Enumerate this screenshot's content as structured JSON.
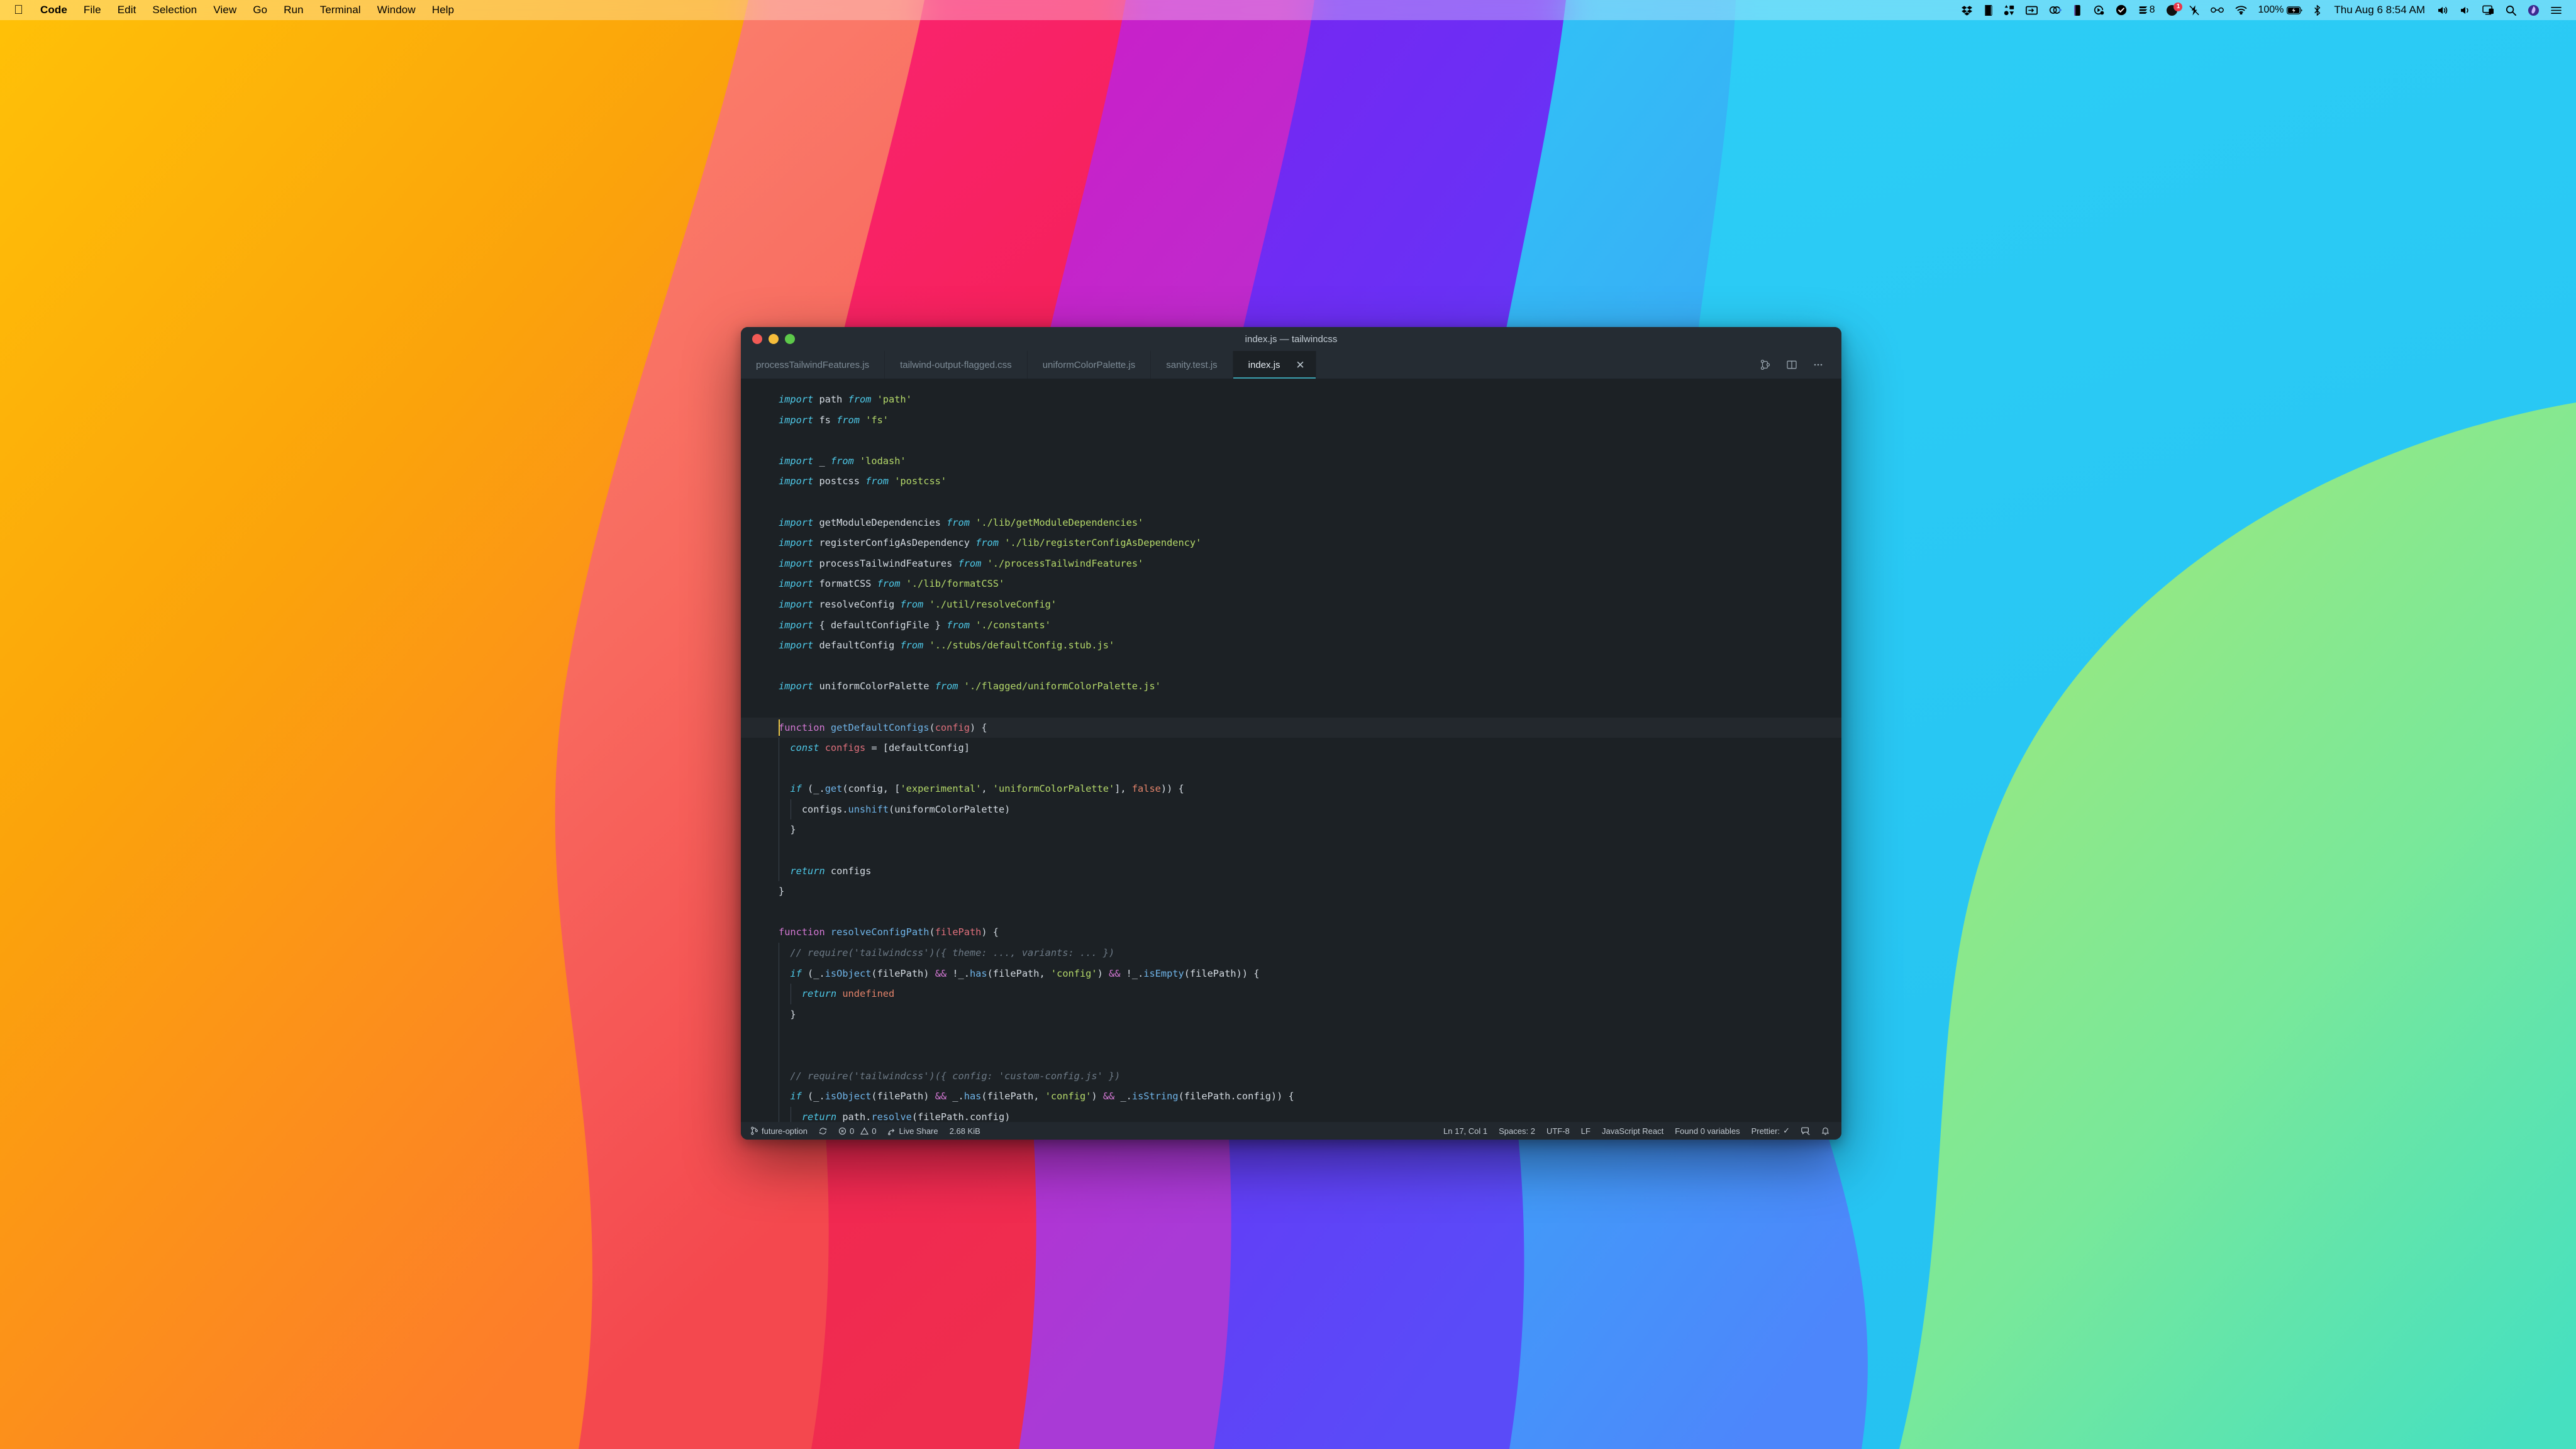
{
  "menubar": {
    "apple_icon": "apple-logo-icon",
    "items": [
      {
        "label": "Code",
        "bold": true
      },
      {
        "label": "File",
        "bold": false
      },
      {
        "label": "Edit",
        "bold": false
      },
      {
        "label": "Selection",
        "bold": false
      },
      {
        "label": "View",
        "bold": false
      },
      {
        "label": "Go",
        "bold": false
      },
      {
        "label": "Run",
        "bold": false
      },
      {
        "label": "Terminal",
        "bold": false
      },
      {
        "label": "Window",
        "bold": false
      },
      {
        "label": "Help",
        "bold": false
      }
    ],
    "status_icons": [
      "dropbox-icon",
      "book-icon",
      "shapes-icon",
      "display-icon",
      "link-icon",
      "book-alt-icon",
      "play-circle-icon",
      "checkmark-circle-icon",
      "layers-icon"
    ],
    "layers_count": "8",
    "notification_badge": "1",
    "dnd_icon": "do-not-disturb-icon",
    "glasses_icon": "glasses-icon",
    "wifi_icon": "wifi-icon",
    "battery_percent": "100%",
    "battery_icon": "battery-charging-icon",
    "bluetooth_icon": "bluetooth-icon",
    "clock": "Thu Aug 6  8:54 AM",
    "volume_icon": "volume-icon",
    "sound_icon": "sound-icon",
    "screen_mirror_icon": "screen-mirroring-icon",
    "search_icon": "spotlight-search-icon",
    "siri_icon": "siri-icon",
    "control_center_icon": "control-center-icon"
  },
  "window": {
    "title": "index.js — tailwindcss",
    "traffic_lights": [
      "close-button",
      "minimize-button",
      "maximize-button"
    ]
  },
  "tabs": [
    {
      "label": "processTailwindFeatures.js",
      "active": false
    },
    {
      "label": "tailwind-output-flagged.css",
      "active": false
    },
    {
      "label": "uniformColorPalette.js",
      "active": false
    },
    {
      "label": "sanity.test.js",
      "active": false
    },
    {
      "label": "index.js",
      "active": true
    }
  ],
  "tab_close_glyph": "✕",
  "tab_actions": [
    "split-diff-icon",
    "split-editor-icon",
    "more-actions-icon"
  ],
  "editor": {
    "accent": "#3b9fae",
    "background": "#1c2125",
    "current_line": 17,
    "lines": [
      {
        "n": 1,
        "tokens": [
          {
            "t": "import",
            "c": "k-imp"
          },
          {
            "t": " path ",
            "c": "k-plain"
          },
          {
            "t": "from",
            "c": "k-imp"
          },
          {
            "t": " ",
            "c": "k-plain"
          },
          {
            "t": "'path'",
            "c": "k-str"
          }
        ]
      },
      {
        "n": 2,
        "tokens": [
          {
            "t": "import",
            "c": "k-imp"
          },
          {
            "t": " fs ",
            "c": "k-plain"
          },
          {
            "t": "from",
            "c": "k-imp"
          },
          {
            "t": " ",
            "c": "k-plain"
          },
          {
            "t": "'fs'",
            "c": "k-str"
          }
        ]
      },
      {
        "n": 3,
        "tokens": []
      },
      {
        "n": 4,
        "tokens": [
          {
            "t": "import",
            "c": "k-imp"
          },
          {
            "t": " _ ",
            "c": "k-plain"
          },
          {
            "t": "from",
            "c": "k-imp"
          },
          {
            "t": " ",
            "c": "k-plain"
          },
          {
            "t": "'lodash'",
            "c": "k-str"
          }
        ]
      },
      {
        "n": 5,
        "tokens": [
          {
            "t": "import",
            "c": "k-imp"
          },
          {
            "t": " postcss ",
            "c": "k-plain"
          },
          {
            "t": "from",
            "c": "k-imp"
          },
          {
            "t": " ",
            "c": "k-plain"
          },
          {
            "t": "'postcss'",
            "c": "k-str"
          }
        ]
      },
      {
        "n": 6,
        "tokens": []
      },
      {
        "n": 7,
        "tokens": [
          {
            "t": "import",
            "c": "k-imp"
          },
          {
            "t": " getModuleDependencies ",
            "c": "k-plain"
          },
          {
            "t": "from",
            "c": "k-imp"
          },
          {
            "t": " ",
            "c": "k-plain"
          },
          {
            "t": "'./lib/getModuleDependencies'",
            "c": "k-str"
          }
        ]
      },
      {
        "n": 8,
        "tokens": [
          {
            "t": "import",
            "c": "k-imp"
          },
          {
            "t": " registerConfigAsDependency ",
            "c": "k-plain"
          },
          {
            "t": "from",
            "c": "k-imp"
          },
          {
            "t": " ",
            "c": "k-plain"
          },
          {
            "t": "'./lib/registerConfigAsDependency'",
            "c": "k-str"
          }
        ]
      },
      {
        "n": 9,
        "tokens": [
          {
            "t": "import",
            "c": "k-imp"
          },
          {
            "t": " processTailwindFeatures ",
            "c": "k-plain"
          },
          {
            "t": "from",
            "c": "k-imp"
          },
          {
            "t": " ",
            "c": "k-plain"
          },
          {
            "t": "'./processTailwindFeatures'",
            "c": "k-str"
          }
        ]
      },
      {
        "n": 10,
        "tokens": [
          {
            "t": "import",
            "c": "k-imp"
          },
          {
            "t": " formatCSS ",
            "c": "k-plain"
          },
          {
            "t": "from",
            "c": "k-imp"
          },
          {
            "t": " ",
            "c": "k-plain"
          },
          {
            "t": "'./lib/formatCSS'",
            "c": "k-str"
          }
        ]
      },
      {
        "n": 11,
        "tokens": [
          {
            "t": "import",
            "c": "k-imp"
          },
          {
            "t": " resolveConfig ",
            "c": "k-plain"
          },
          {
            "t": "from",
            "c": "k-imp"
          },
          {
            "t": " ",
            "c": "k-plain"
          },
          {
            "t": "'./util/resolveConfig'",
            "c": "k-str"
          }
        ]
      },
      {
        "n": 12,
        "tokens": [
          {
            "t": "import",
            "c": "k-imp"
          },
          {
            "t": " { defaultConfigFile } ",
            "c": "k-plain"
          },
          {
            "t": "from",
            "c": "k-imp"
          },
          {
            "t": " ",
            "c": "k-plain"
          },
          {
            "t": "'./constants'",
            "c": "k-str"
          }
        ]
      },
      {
        "n": 13,
        "tokens": [
          {
            "t": "import",
            "c": "k-imp"
          },
          {
            "t": " defaultConfig ",
            "c": "k-plain"
          },
          {
            "t": "from",
            "c": "k-imp"
          },
          {
            "t": " ",
            "c": "k-plain"
          },
          {
            "t": "'../stubs/defaultConfig.stub.js'",
            "c": "k-str"
          }
        ]
      },
      {
        "n": 14,
        "tokens": []
      },
      {
        "n": 15,
        "tokens": [
          {
            "t": "import",
            "c": "k-imp"
          },
          {
            "t": " uniformColorPalette ",
            "c": "k-plain"
          },
          {
            "t": "from",
            "c": "k-imp"
          },
          {
            "t": " ",
            "c": "k-plain"
          },
          {
            "t": "'./flagged/uniformColorPalette.js'",
            "c": "k-str"
          }
        ]
      },
      {
        "n": 16,
        "tokens": []
      },
      {
        "n": 17,
        "cur": true,
        "tokens": [
          {
            "t": "function",
            "c": "k-kw"
          },
          {
            "t": " ",
            "c": "k-plain"
          },
          {
            "t": "getDefaultConfigs",
            "c": "k-fn"
          },
          {
            "t": "(",
            "c": "k-punc"
          },
          {
            "t": "config",
            "c": "k-param"
          },
          {
            "t": ") {",
            "c": "k-punc"
          }
        ]
      },
      {
        "n": 18,
        "indent": 1,
        "tokens": [
          {
            "t": "  ",
            "c": "k-plain"
          },
          {
            "t": "const",
            "c": "k-imp"
          },
          {
            "t": " ",
            "c": "k-plain"
          },
          {
            "t": "configs",
            "c": "k-param"
          },
          {
            "t": " = [defaultConfig]",
            "c": "k-plain"
          }
        ]
      },
      {
        "n": 19,
        "indent": 1,
        "tokens": []
      },
      {
        "n": 20,
        "indent": 1,
        "tokens": [
          {
            "t": "  ",
            "c": "k-plain"
          },
          {
            "t": "if",
            "c": "k-imp"
          },
          {
            "t": " (_.",
            "c": "k-plain"
          },
          {
            "t": "get",
            "c": "k-fn"
          },
          {
            "t": "(config, [",
            "c": "k-plain"
          },
          {
            "t": "'experimental'",
            "c": "k-str"
          },
          {
            "t": ", ",
            "c": "k-plain"
          },
          {
            "t": "'uniformColorPalette'",
            "c": "k-str"
          },
          {
            "t": "], ",
            "c": "k-plain"
          },
          {
            "t": "false",
            "c": "k-const"
          },
          {
            "t": ")) {",
            "c": "k-plain"
          }
        ]
      },
      {
        "n": 21,
        "indent": 2,
        "tokens": [
          {
            "t": "    configs.",
            "c": "k-plain"
          },
          {
            "t": "unshift",
            "c": "k-fn"
          },
          {
            "t": "(uniformColorPalette)",
            "c": "k-plain"
          }
        ]
      },
      {
        "n": 22,
        "indent": 1,
        "tokens": [
          {
            "t": "  }",
            "c": "k-plain"
          }
        ]
      },
      {
        "n": 23,
        "indent": 1,
        "tokens": []
      },
      {
        "n": 24,
        "indent": 1,
        "tokens": [
          {
            "t": "  ",
            "c": "k-plain"
          },
          {
            "t": "return",
            "c": "k-imp"
          },
          {
            "t": " configs",
            "c": "k-plain"
          }
        ]
      },
      {
        "n": 25,
        "tokens": [
          {
            "t": "}",
            "c": "k-plain"
          }
        ]
      },
      {
        "n": 26,
        "tokens": []
      },
      {
        "n": 27,
        "tokens": [
          {
            "t": "function",
            "c": "k-kw"
          },
          {
            "t": " ",
            "c": "k-plain"
          },
          {
            "t": "resolveConfigPath",
            "c": "k-fn"
          },
          {
            "t": "(",
            "c": "k-punc"
          },
          {
            "t": "filePath",
            "c": "k-param"
          },
          {
            "t": ") {",
            "c": "k-punc"
          }
        ]
      },
      {
        "n": 28,
        "indent": 1,
        "tokens": [
          {
            "t": "  // require('tailwindcss')({ theme: ..., variants: ... })",
            "c": "k-cmt"
          }
        ]
      },
      {
        "n": 29,
        "indent": 1,
        "tokens": [
          {
            "t": "  ",
            "c": "k-plain"
          },
          {
            "t": "if",
            "c": "k-imp"
          },
          {
            "t": " (_.",
            "c": "k-plain"
          },
          {
            "t": "isObject",
            "c": "k-fn"
          },
          {
            "t": "(filePath) ",
            "c": "k-plain"
          },
          {
            "t": "&&",
            "c": "k-op"
          },
          {
            "t": " !_.",
            "c": "k-plain"
          },
          {
            "t": "has",
            "c": "k-fn"
          },
          {
            "t": "(filePath, ",
            "c": "k-plain"
          },
          {
            "t": "'config'",
            "c": "k-str"
          },
          {
            "t": ") ",
            "c": "k-plain"
          },
          {
            "t": "&&",
            "c": "k-op"
          },
          {
            "t": " !_.",
            "c": "k-plain"
          },
          {
            "t": "isEmpty",
            "c": "k-fn"
          },
          {
            "t": "(filePath)) {",
            "c": "k-plain"
          }
        ]
      },
      {
        "n": 30,
        "indent": 2,
        "tokens": [
          {
            "t": "    ",
            "c": "k-plain"
          },
          {
            "t": "return",
            "c": "k-imp"
          },
          {
            "t": " ",
            "c": "k-plain"
          },
          {
            "t": "undefined",
            "c": "k-const"
          }
        ]
      },
      {
        "n": 31,
        "indent": 1,
        "tokens": [
          {
            "t": "  }",
            "c": "k-plain"
          }
        ]
      },
      {
        "n": 32,
        "indent": 1,
        "tokens": []
      },
      {
        "n": 33,
        "indent": 1,
        "tokens": []
      },
      {
        "n": 34,
        "indent": 1,
        "tokens": [
          {
            "t": "  // require('tailwindcss')({ config: 'custom-config.js' })",
            "c": "k-cmt"
          }
        ]
      },
      {
        "n": 35,
        "indent": 1,
        "tokens": [
          {
            "t": "  ",
            "c": "k-plain"
          },
          {
            "t": "if",
            "c": "k-imp"
          },
          {
            "t": " (_.",
            "c": "k-plain"
          },
          {
            "t": "isObject",
            "c": "k-fn"
          },
          {
            "t": "(filePath) ",
            "c": "k-plain"
          },
          {
            "t": "&&",
            "c": "k-op"
          },
          {
            "t": " _.",
            "c": "k-plain"
          },
          {
            "t": "has",
            "c": "k-fn"
          },
          {
            "t": "(filePath, ",
            "c": "k-plain"
          },
          {
            "t": "'config'",
            "c": "k-str"
          },
          {
            "t": ") ",
            "c": "k-plain"
          },
          {
            "t": "&&",
            "c": "k-op"
          },
          {
            "t": " _.",
            "c": "k-plain"
          },
          {
            "t": "isString",
            "c": "k-fn"
          },
          {
            "t": "(filePath.config)) {",
            "c": "k-plain"
          }
        ]
      },
      {
        "n": 36,
        "indent": 2,
        "tokens": [
          {
            "t": "    ",
            "c": "k-plain"
          },
          {
            "t": "return",
            "c": "k-imp"
          },
          {
            "t": " path.",
            "c": "k-plain"
          },
          {
            "t": "resolve",
            "c": "k-fn"
          },
          {
            "t": "(filePath.config)",
            "c": "k-plain"
          }
        ]
      },
      {
        "n": 37,
        "indent": 1,
        "tokens": [
          {
            "t": "  }",
            "c": "k-plain"
          }
        ]
      }
    ]
  },
  "statusbar": {
    "branch_icon": "source-control-branch-icon",
    "branch": "future-option",
    "sync_icon": "sync-icon",
    "error_icon": "error-icon",
    "errors": "0",
    "warning_icon": "warning-icon",
    "warnings": "0",
    "live_share_icon": "live-share-icon",
    "live_share": "Live Share",
    "file_size": "2.68 KiB",
    "cursor_position": "Ln 17, Col 1",
    "indentation": "Spaces: 2",
    "encoding": "UTF-8",
    "eol": "LF",
    "language_mode": "JavaScript React",
    "variables": "Found 0 variables",
    "formatter": "Prettier:",
    "formatter_status": "✓",
    "feedback_icon": "feedback-icon",
    "bell_icon": "notification-bell-icon"
  }
}
